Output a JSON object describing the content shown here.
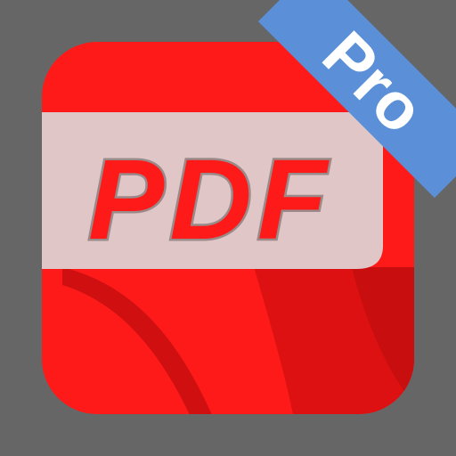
{
  "app_icon": {
    "main_label": "PDF",
    "ribbon_label": "Pro",
    "colors": {
      "background": "#666666",
      "tile_red": "#FF1A1A",
      "tile_dark_red": "#DD1111",
      "label_band": "#E0C6C6",
      "label_text": "#FF1A1A",
      "label_outline": "#9A8A8A",
      "ribbon": "#5B90D8",
      "ribbon_text": "#FFFFFF"
    },
    "icons": [
      "pdf-document-tile-icon",
      "pro-corner-ribbon"
    ]
  }
}
